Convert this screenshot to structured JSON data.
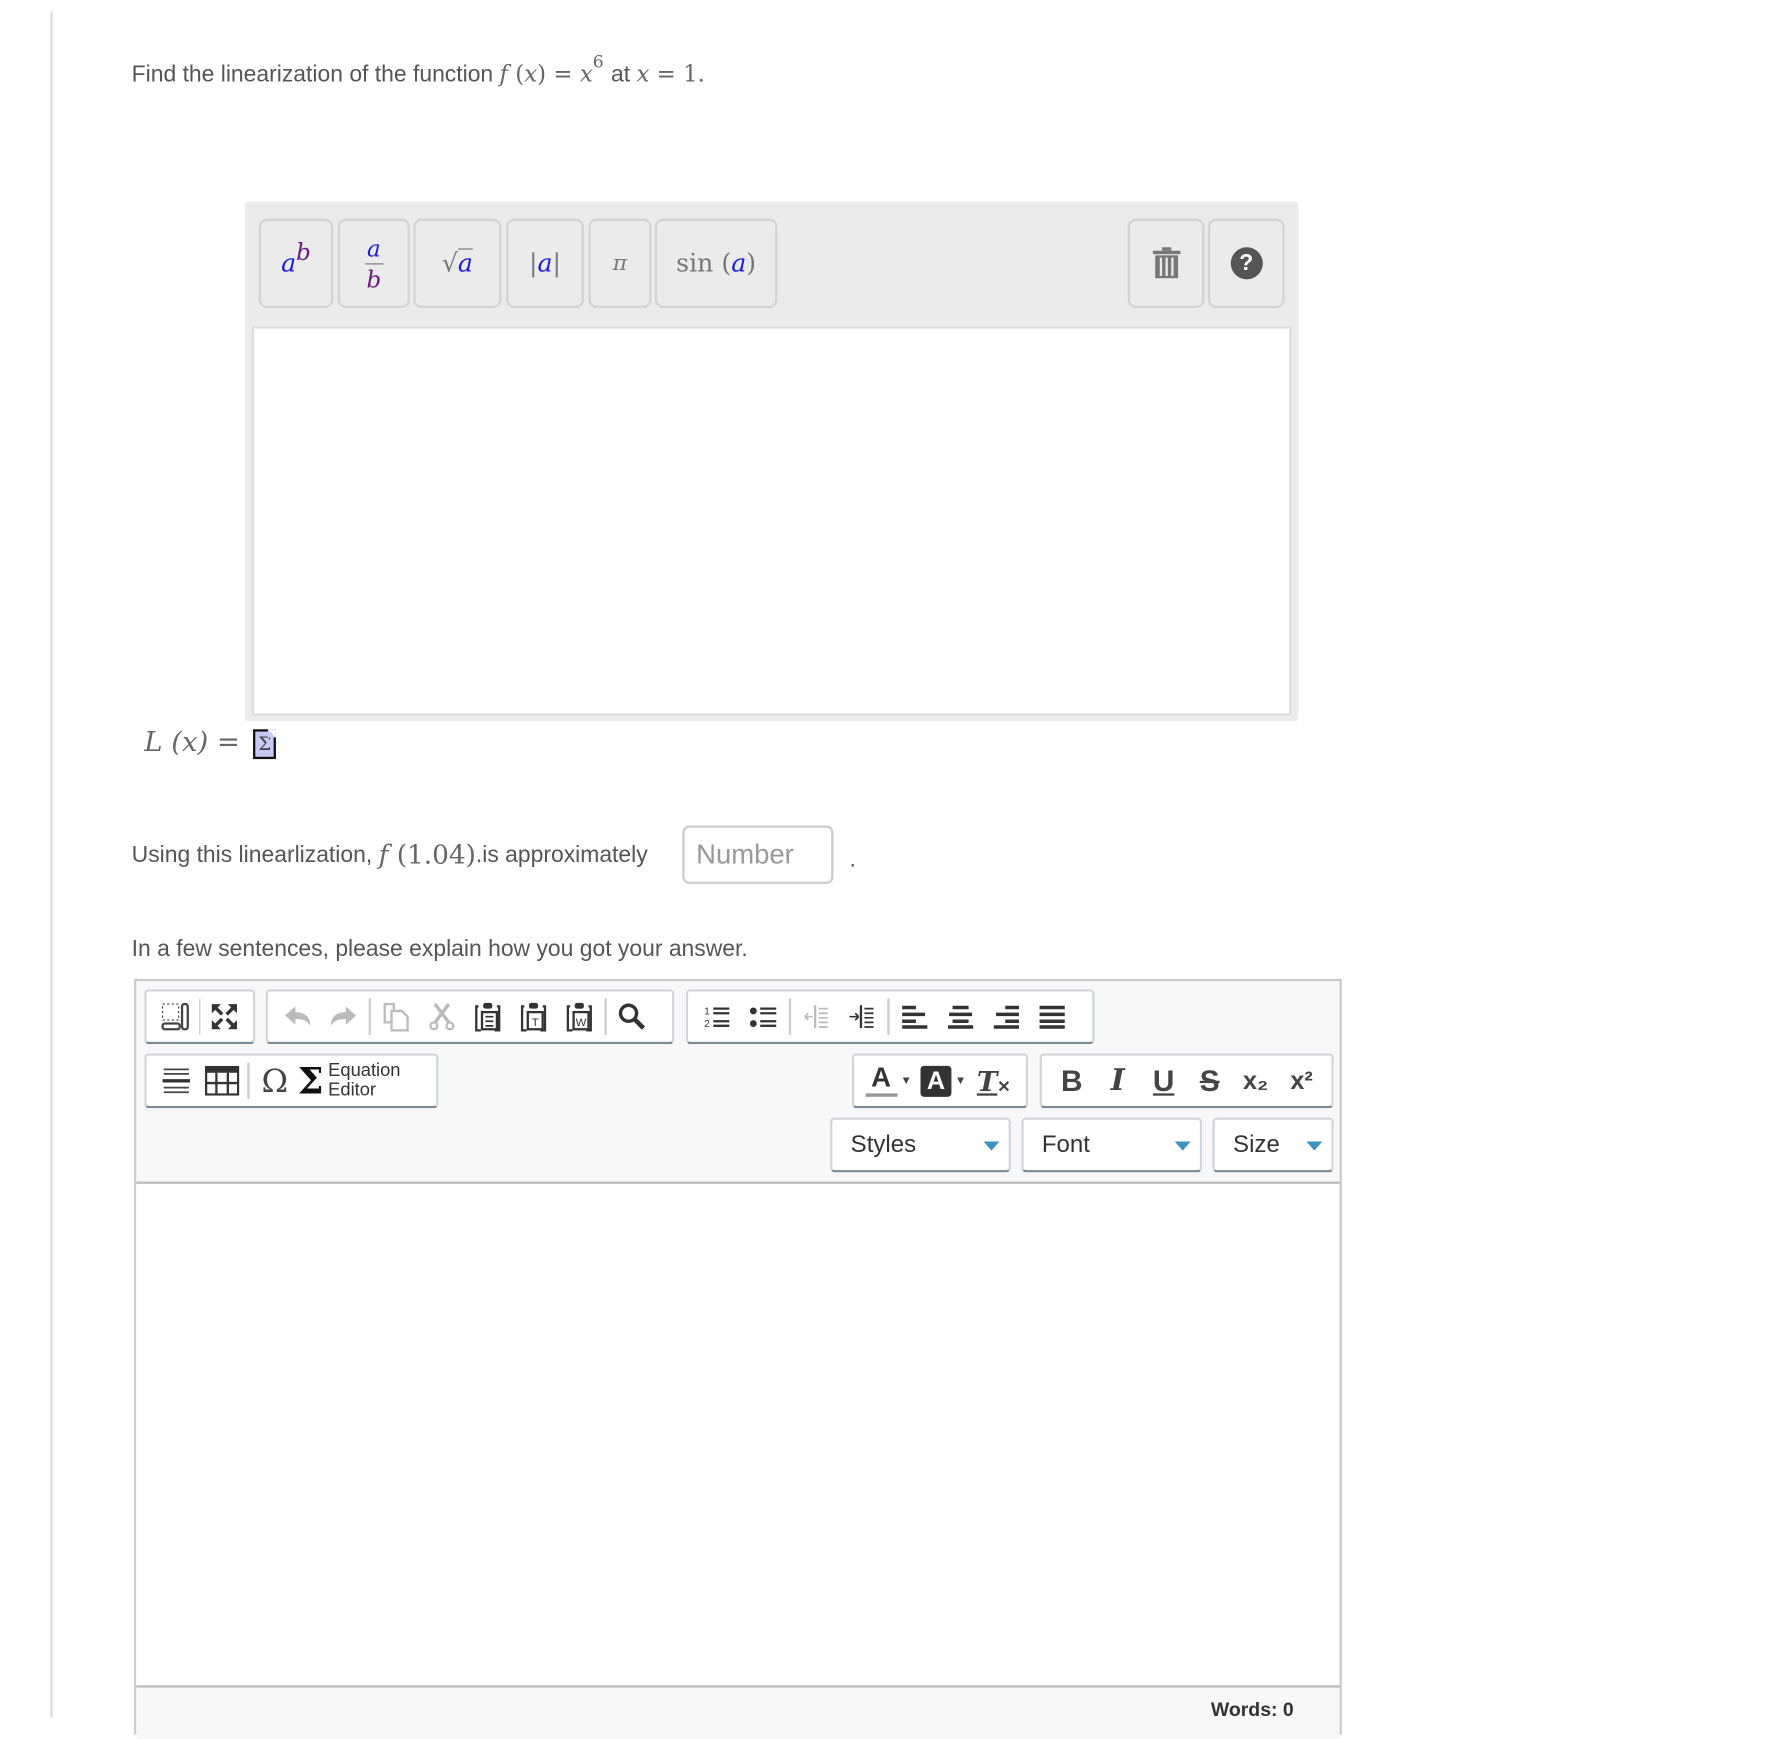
{
  "question": {
    "prefix": "Find the linearization of the function",
    "function_lhs": "f (x) =",
    "base": "x",
    "exponent": "6",
    "at_text": "at",
    "point": "x = 1."
  },
  "math_editor": {
    "buttons": [
      {
        "id": "power",
        "label": "a^b",
        "base": "a",
        "sup": "b"
      },
      {
        "id": "fraction",
        "label": "a/b",
        "num": "a",
        "den": "b"
      },
      {
        "id": "sqrt",
        "label": "√a",
        "radical": "√",
        "arg": "a"
      },
      {
        "id": "abs",
        "label": "|a|",
        "bar": "|",
        "arg": "a"
      },
      {
        "id": "pi",
        "label": "π"
      },
      {
        "id": "sin",
        "label": "sin (a)",
        "fn": "sin (",
        "arg": "a",
        "close": ")"
      }
    ],
    "trash_icon": "trash-icon",
    "help_icon": "question-circle-icon",
    "help_glyph": "?",
    "value": ""
  },
  "answer_label": {
    "text": "L (x) =",
    "icon": "equation-sigma-icon",
    "icon_glyph": "Σ"
  },
  "approx": {
    "prefix": "Using this linearlization,",
    "expr": "f (1.04)",
    "suffix": ".is approximately",
    "input_placeholder": "Number",
    "input_value": "",
    "trailing": "."
  },
  "explain": {
    "prompt": "In a few sentences, please explain how you got your answer."
  },
  "rich_editor": {
    "toolbar_row1": {
      "group1": [
        "show-blocks",
        "maximize"
      ],
      "group2": [
        "undo",
        "redo",
        "copy",
        "cut",
        "paste",
        "paste-text",
        "paste-word",
        "find"
      ],
      "group3": [
        "numbered-list",
        "bulleted-list",
        "outdent",
        "indent",
        "align-left",
        "align-center",
        "align-right",
        "justify"
      ]
    },
    "toolbar_row2": {
      "equation_editor_line1": "Equation",
      "equation_editor_line2": "Editor",
      "omega_glyph": "Ω",
      "sigma_glyph": "Σ",
      "text_color_glyph": "A",
      "bg_color_glyph": "A",
      "remove_format_glyph": "T",
      "bold": "B",
      "italic": "I",
      "underline": "U",
      "strike": "S",
      "subscript": "x₂",
      "superscript": "x²"
    },
    "combos": {
      "styles": "Styles",
      "font": "Font",
      "size": "Size"
    },
    "content": "",
    "word_count": "Words: 0"
  }
}
